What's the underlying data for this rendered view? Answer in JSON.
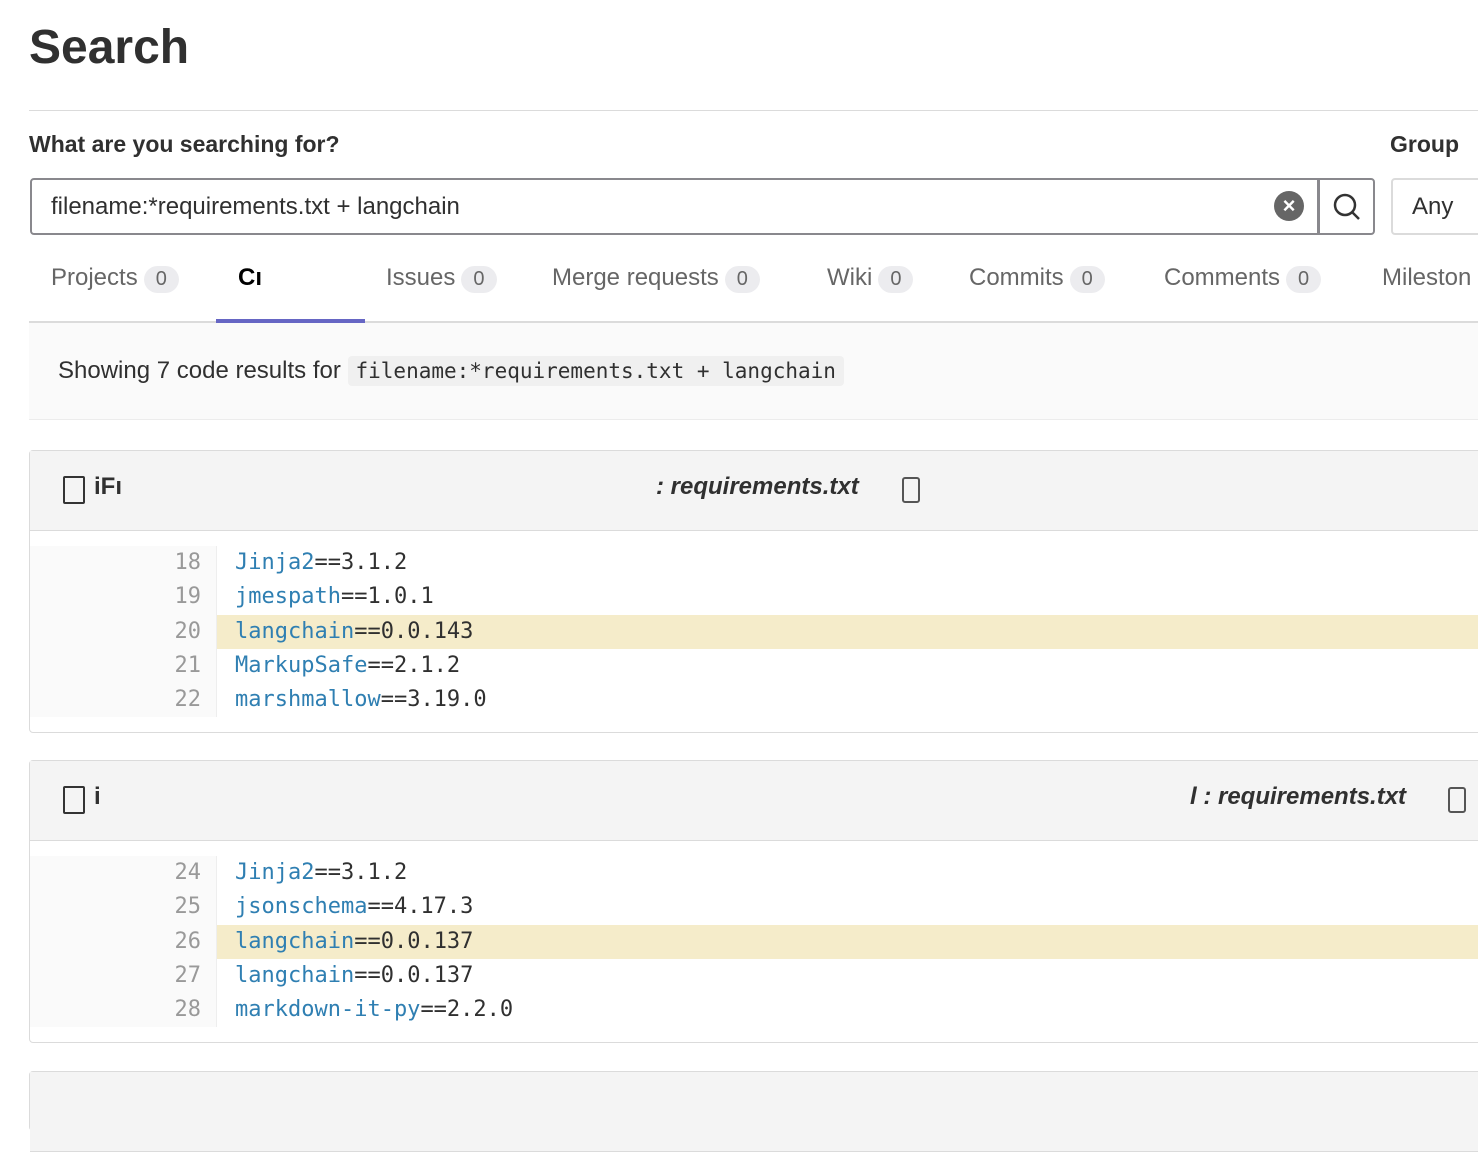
{
  "page_title": "Search",
  "search": {
    "label": "What are you searching for?",
    "value": "filename:*requirements.txt  + langchain",
    "group_label": "Group",
    "group_value": "Any"
  },
  "tabs": [
    {
      "label": "Projects",
      "count": "0"
    },
    {
      "label": "Cı",
      "count": "",
      "active": true
    },
    {
      "label": "Issues",
      "count": "0"
    },
    {
      "label": "Merge requests",
      "count": "0"
    },
    {
      "label": "Wiki",
      "count": "0"
    },
    {
      "label": "Commits",
      "count": "0"
    },
    {
      "label": "Comments",
      "count": "0"
    },
    {
      "label": "Mileston",
      "count": ""
    }
  ],
  "summary": {
    "text": "Showing 7 code results for",
    "query": "filename:*requirements.txt + langchain"
  },
  "results": [
    {
      "lead": "iFı",
      "file": ": requirements.txt",
      "lines": [
        {
          "n": "18",
          "pkg": "Jinja2",
          "ver": "==3.1.2"
        },
        {
          "n": "19",
          "pkg": "jmespath",
          "ver": "==1.0.1"
        },
        {
          "n": "20",
          "pkg": "langchain",
          "ver": "==0.0.143",
          "hl": true
        },
        {
          "n": "21",
          "pkg": "MarkupSafe",
          "ver": "==2.1.2"
        },
        {
          "n": "22",
          "pkg": "marshmallow",
          "ver": "==3.19.0"
        }
      ]
    },
    {
      "lead": "i",
      "file": "l : requirements.txt",
      "lines": [
        {
          "n": "24",
          "pkg": "Jinja2",
          "ver": "==3.1.2"
        },
        {
          "n": "25",
          "pkg": "jsonschema",
          "ver": "==4.17.3"
        },
        {
          "n": "26",
          "pkg": "langchain",
          "ver": "==0.0.137",
          "hl": true
        },
        {
          "n": "27",
          "pkg": "langchain",
          "ver": "==0.0.137"
        },
        {
          "n": "28",
          "pkg": "markdown-it-py",
          "ver": "==2.2.0"
        }
      ]
    }
  ],
  "colors": {
    "active_tab": "#6666c4",
    "highlight": "#f5ecca",
    "package": "#2f7fb2"
  }
}
